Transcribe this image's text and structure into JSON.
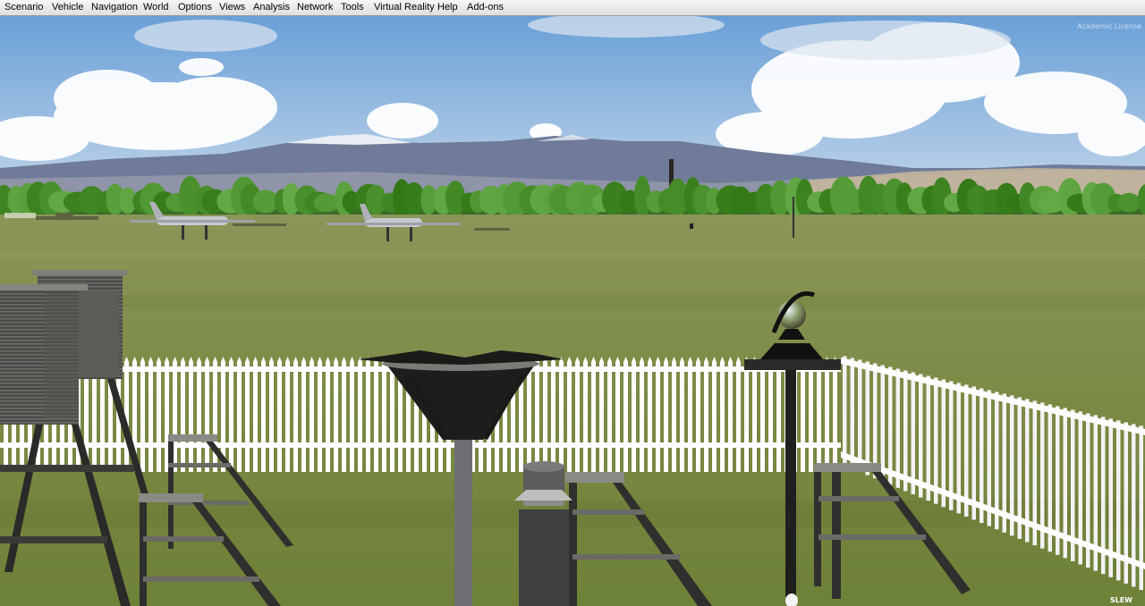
{
  "menu": [
    {
      "label": "Scenario",
      "name": "menu-scenario"
    },
    {
      "label": "Vehicle",
      "name": "menu-vehicle"
    },
    {
      "label": "Navigation",
      "name": "menu-navigation"
    },
    {
      "label": "World",
      "name": "menu-world"
    },
    {
      "label": "Options",
      "name": "menu-options"
    },
    {
      "label": "Views",
      "name": "menu-views"
    },
    {
      "label": "Analysis",
      "name": "menu-analysis"
    },
    {
      "label": "Network",
      "name": "menu-network"
    },
    {
      "label": "Tools",
      "name": "menu-tools"
    },
    {
      "label": "Virtual Reality",
      "name": "menu-virtual-reality"
    },
    {
      "label": "Help",
      "name": "menu-help"
    },
    {
      "label": "Add-ons",
      "name": "menu-add-ons"
    }
  ],
  "overlay": {
    "license": "Academic License",
    "mode": "SLEW"
  },
  "scene": {
    "sky_top": "#6aa0d8",
    "sky_bottom": "#c6d8ea",
    "grass": "#7c8b46",
    "fence": "#ffffff",
    "mountains": "#6a7690"
  }
}
